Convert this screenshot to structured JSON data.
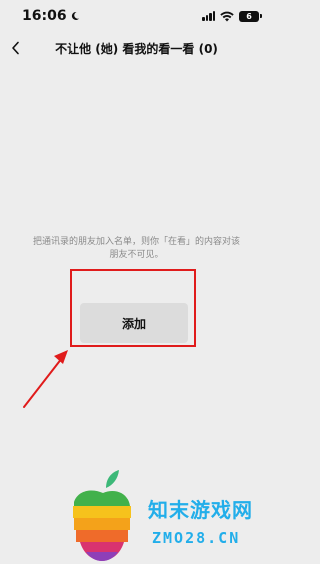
{
  "status_bar": {
    "time": "16:06",
    "battery_level": "6"
  },
  "header": {
    "title": "不让他 (她) 看我的看一看 (0)"
  },
  "main": {
    "hint_line1": "把通讯录的朋友加入名单，则你「在看」的内容对该",
    "hint_line2": "朋友不可见。",
    "add_button_label": "添加"
  },
  "watermark": {
    "title": "知末游戏网",
    "domain": "ZMO28.CN"
  },
  "colors": {
    "background": "#ededed",
    "highlight": "#e01b1b",
    "button_bg": "#dcdcdc",
    "watermark": "#22aeea"
  },
  "icons": [
    "moon-icon",
    "signal-icon",
    "wifi-icon",
    "battery-icon",
    "back-arrow-icon",
    "annotation-arrow"
  ]
}
